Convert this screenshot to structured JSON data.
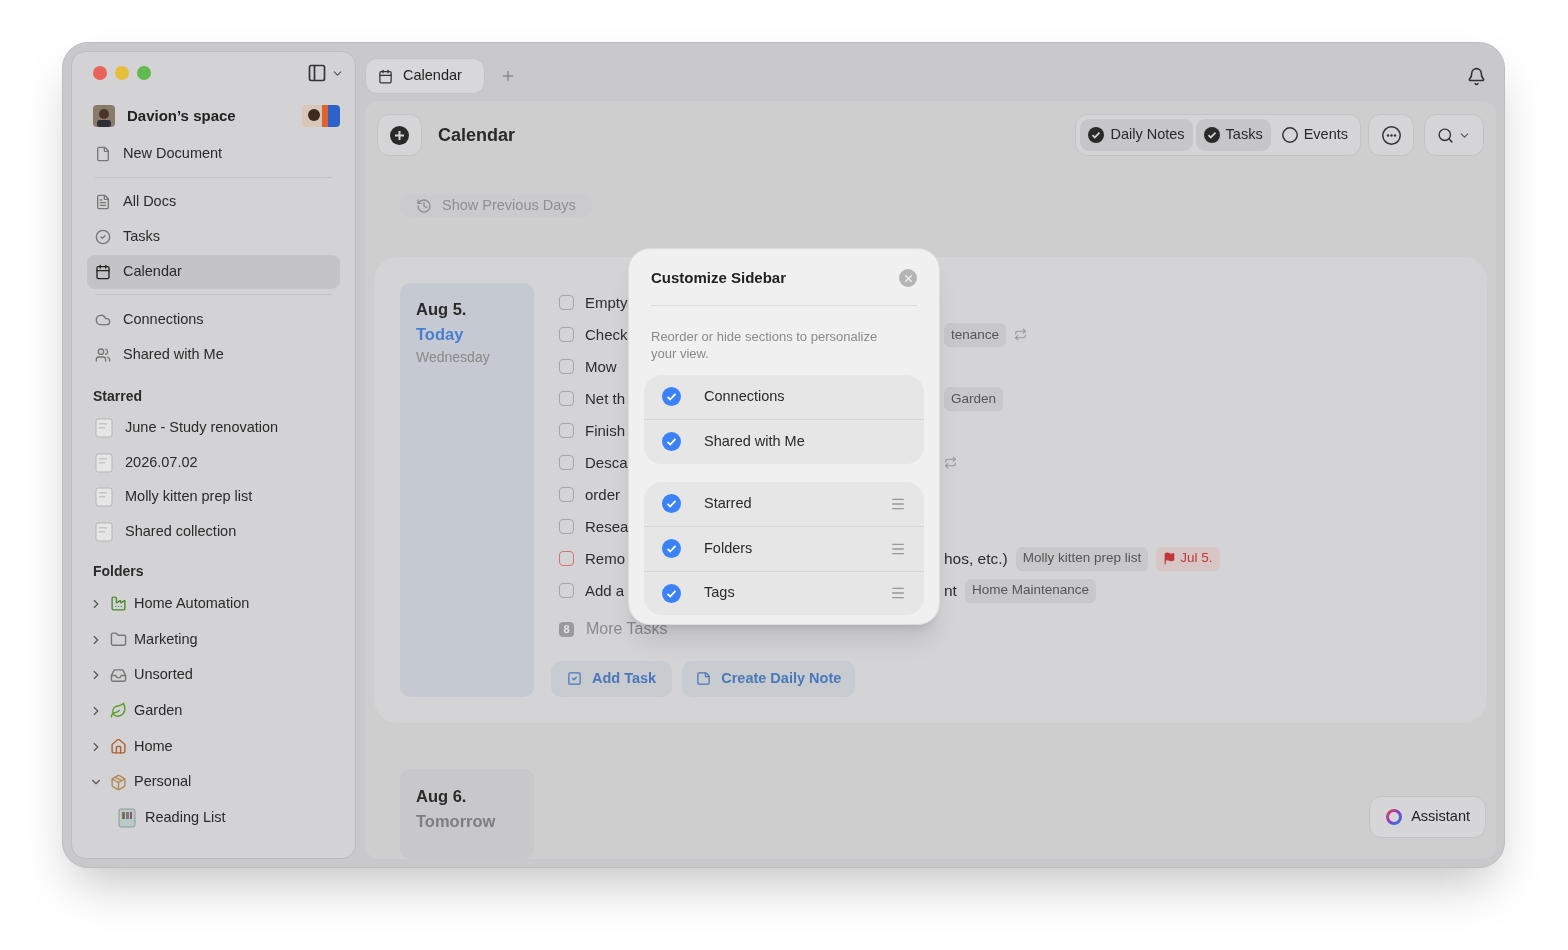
{
  "tabs": [
    {
      "label": "Calendar",
      "selected": true
    }
  ],
  "sidebar": {
    "workspace": "Davion’s space",
    "new_document": "New Document",
    "nav": [
      {
        "label": "All Docs",
        "kind": "docs",
        "selected": false
      },
      {
        "label": "Tasks",
        "kind": "tasks",
        "selected": false
      },
      {
        "label": "Calendar",
        "kind": "calendar",
        "selected": true
      }
    ],
    "nav2": [
      {
        "label": "Connections",
        "kind": "cloud",
        "selected": false
      },
      {
        "label": "Shared with Me",
        "kind": "shared",
        "selected": false
      }
    ],
    "starred_title": "Starred",
    "starred": [
      "June - Study renovation",
      "2026.07.02",
      "Molly kitten prep list",
      "Shared collection"
    ],
    "folders_title": "Folders",
    "folders": [
      {
        "label": "Home Automation",
        "kind": "automation",
        "expanded": false
      },
      {
        "label": "Marketing",
        "kind": "folder",
        "expanded": false
      },
      {
        "label": "Unsorted",
        "kind": "inbox",
        "expanded": false
      },
      {
        "label": "Garden",
        "kind": "leaf",
        "expanded": false
      },
      {
        "label": "Home",
        "kind": "house",
        "expanded": false
      },
      {
        "label": "Personal",
        "kind": "box",
        "expanded": true,
        "children": [
          {
            "label": "Reading List"
          }
        ]
      }
    ]
  },
  "header": {
    "title": "Calendar",
    "filters": [
      {
        "label": "Daily Notes",
        "selected": true
      },
      {
        "label": "Tasks",
        "selected": true
      },
      {
        "label": "Events",
        "selected": false
      }
    ]
  },
  "show_previous": "Show Previous Days",
  "today": {
    "date": "Aug 5.",
    "relative": "Today",
    "weekday": "Wednesday",
    "tasks": [
      {
        "title": "Empty",
        "color": "#a6a6a8",
        "repeat": false
      },
      {
        "title": "Check",
        "color": "#a6a6a8",
        "tags": [
          {
            "text": "tenance",
            "kind": "tag"
          }
        ],
        "repeat": true
      },
      {
        "title": "Mow",
        "color": "#a6a6a8",
        "repeat": false
      },
      {
        "title": "Net th",
        "color": "#a6a6a8",
        "tags": [
          {
            "text": "Garden",
            "kind": "tag"
          }
        ],
        "repeat": false
      },
      {
        "title": "Finish",
        "color": "#a6a6a8",
        "repeat": false
      },
      {
        "title": "Desca",
        "color": "#a6a6a8",
        "repeat": true
      },
      {
        "title": "order",
        "color": "#a6a6a8",
        "repeat": false
      },
      {
        "title": "Resea",
        "color": "#a6a6a8",
        "repeat": false
      },
      {
        "title": "Remo",
        "color": "#d0737b",
        "end": "hos, etc.)",
        "tags": [
          {
            "text": "Molly kitten prep list",
            "kind": "tag"
          },
          {
            "text": "Jul 5.",
            "kind": "date"
          }
        ],
        "repeat": false
      },
      {
        "title": "Add a",
        "color": "#a6a6a8",
        "end": "nt",
        "tags": [
          {
            "text": "Home Maintenance",
            "kind": "tag"
          }
        ],
        "repeat": false
      }
    ],
    "more_count": "8",
    "more_label": "More Tasks",
    "add_task": "Add Task",
    "create_note": "Create Daily Note"
  },
  "tomorrow": {
    "date": "Aug 6.",
    "relative": "Tomorrow"
  },
  "assistant": "Assistant",
  "modal": {
    "title": "Customize Sidebar",
    "description": "Reorder or hide sections to personalize your view.",
    "groups": [
      {
        "reorderable": false,
        "items": [
          {
            "label": "Connections",
            "checked": true
          },
          {
            "label": "Shared with Me",
            "checked": true
          }
        ]
      },
      {
        "reorderable": true,
        "items": [
          {
            "label": "Starred",
            "checked": true
          },
          {
            "label": "Folders",
            "checked": true
          },
          {
            "label": "Tags",
            "checked": true
          }
        ]
      }
    ]
  }
}
